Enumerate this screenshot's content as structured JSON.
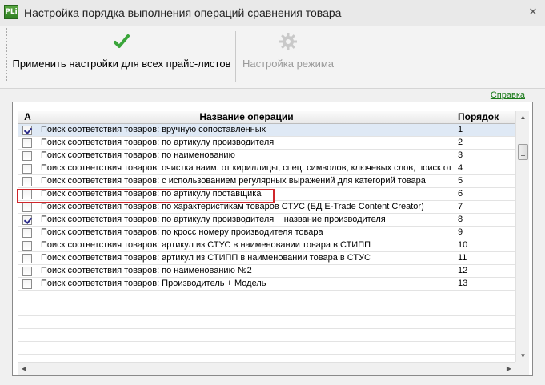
{
  "window": {
    "title": "Настройка порядка выполнения операций сравнения товара",
    "app_icon_text": "PLi"
  },
  "toolbar": {
    "apply_label": "Применить настройки для всех прайс-листов",
    "mode_label": "Настройка режима"
  },
  "help_link": "Справка",
  "grid": {
    "columns": [
      "A",
      "Название операции",
      "Порядок"
    ],
    "rows": [
      {
        "checked": true,
        "name": "Поиск соответствия товаров: вручную сопоставленных",
        "order": "1"
      },
      {
        "checked": false,
        "name": "Поиск соответствия товаров: по артикулу производителя",
        "order": "2"
      },
      {
        "checked": false,
        "name": "Поиск соответствия товаров: по наименованию",
        "order": "3"
      },
      {
        "checked": false,
        "name": "Поиск соответствия товаров: очистка наим. от кириллицы, спец. символов, ключевых слов, поиск от",
        "order": "4"
      },
      {
        "checked": false,
        "name": "Поиск соответствия товаров: с использованием регулярных выражений для категорий товара",
        "order": "5"
      },
      {
        "checked": false,
        "name": "Поиск соответствия товаров: по артикулу поставщика",
        "order": "6"
      },
      {
        "checked": false,
        "name": "Поиск соответствия товаров: по характеристикам товаров СТУС (БД E-Trade Content Creator)",
        "order": "7"
      },
      {
        "checked": true,
        "name": "Поиск соответствия товаров: по артикулу производителя + название производителя",
        "order": "8"
      },
      {
        "checked": false,
        "name": "Поиск соответствия товаров: по кросс номеру производителя товара",
        "order": "9"
      },
      {
        "checked": false,
        "name": "Поиск соответствия товаров: артикул из СТУС в наименовании товара в СТИПП",
        "order": "10"
      },
      {
        "checked": false,
        "name": "Поиск соответствия товаров: артикул из СТИПП в наименовании товара в СТУС",
        "order": "11"
      },
      {
        "checked": false,
        "name": "Поиск соответствия товаров: по наименованию №2",
        "order": "12"
      },
      {
        "checked": false,
        "name": "Поиск соответствия товаров: Производитель + Модель",
        "order": "13"
      }
    ],
    "selected_row": 0,
    "highlighted_row": 5
  },
  "colors": {
    "highlight_border": "#d0262b",
    "link": "#1a7a1a",
    "selected_row": "#dfe9f5"
  },
  "icons": {
    "apply": "green-checkmark-icon",
    "mode": "gear-icon",
    "close": "close-icon"
  }
}
